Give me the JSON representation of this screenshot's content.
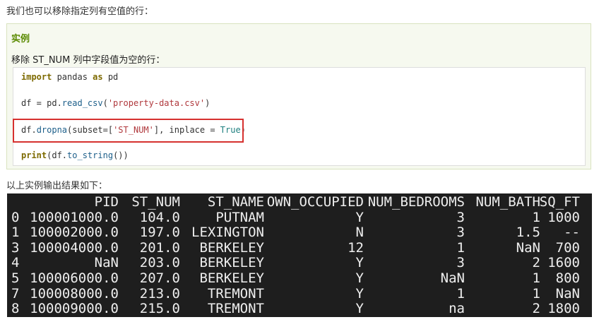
{
  "intro": "我们也可以移除指定列有空值的行：",
  "example": {
    "title": "实例",
    "description": "移除 ST_NUM 列中字段值为空的行：",
    "code": {
      "l1_import": "import",
      "l1_mid": " pandas ",
      "l1_as": "as",
      "l1_end": " pd",
      "l2_a": "df = pd.",
      "l2_fn": "read_csv",
      "l2_b": "(",
      "l2_str": "'property-data.csv'",
      "l2_c": ")",
      "l3_a": "df.",
      "l3_fn": "dropna",
      "l3_b": "(subset=[",
      "l3_str": "'ST_NUM'",
      "l3_c": "], inplace = ",
      "l3_bool": "True",
      "l3_d": ")",
      "l4_kw": "print",
      "l4_a": "(df.",
      "l4_fn": "to_string",
      "l4_b": "())"
    }
  },
  "output_label": "以上实例输出结果如下：",
  "output": {
    "header": [
      "",
      "PID",
      "ST_NUM",
      "ST_NAME",
      "OWN_OCCUPIED",
      "NUM_BEDROOMS",
      "NUM_BATH",
      "SQ_FT"
    ],
    "rows": [
      [
        "0",
        "100001000.0",
        "104.0",
        "PUTNAM",
        "Y",
        "3",
        "1",
        "1000"
      ],
      [
        "1",
        "100002000.0",
        "197.0",
        "LEXINGTON",
        "N",
        "3",
        "1.5",
        "--"
      ],
      [
        "3",
        "100004000.0",
        "201.0",
        "BERKELEY",
        "12",
        "1",
        "NaN",
        "700"
      ],
      [
        "4",
        "NaN",
        "203.0",
        "BERKELEY",
        "Y",
        "3",
        "2",
        "1600"
      ],
      [
        "5",
        "100006000.0",
        "207.0",
        "BERKELEY",
        "Y",
        "NaN",
        "1",
        "800"
      ],
      [
        "7",
        "100008000.0",
        "213.0",
        "TREMONT",
        "Y",
        "1",
        "1",
        "NaN"
      ],
      [
        "8",
        "100009000.0",
        "215.0",
        "TREMONT",
        "Y",
        "na",
        "2",
        "1800"
      ]
    ]
  },
  "colors": {
    "title_green": "#5a8a00",
    "highlight_red": "#d6312f",
    "terminal_bg": "#1e1e1e"
  }
}
